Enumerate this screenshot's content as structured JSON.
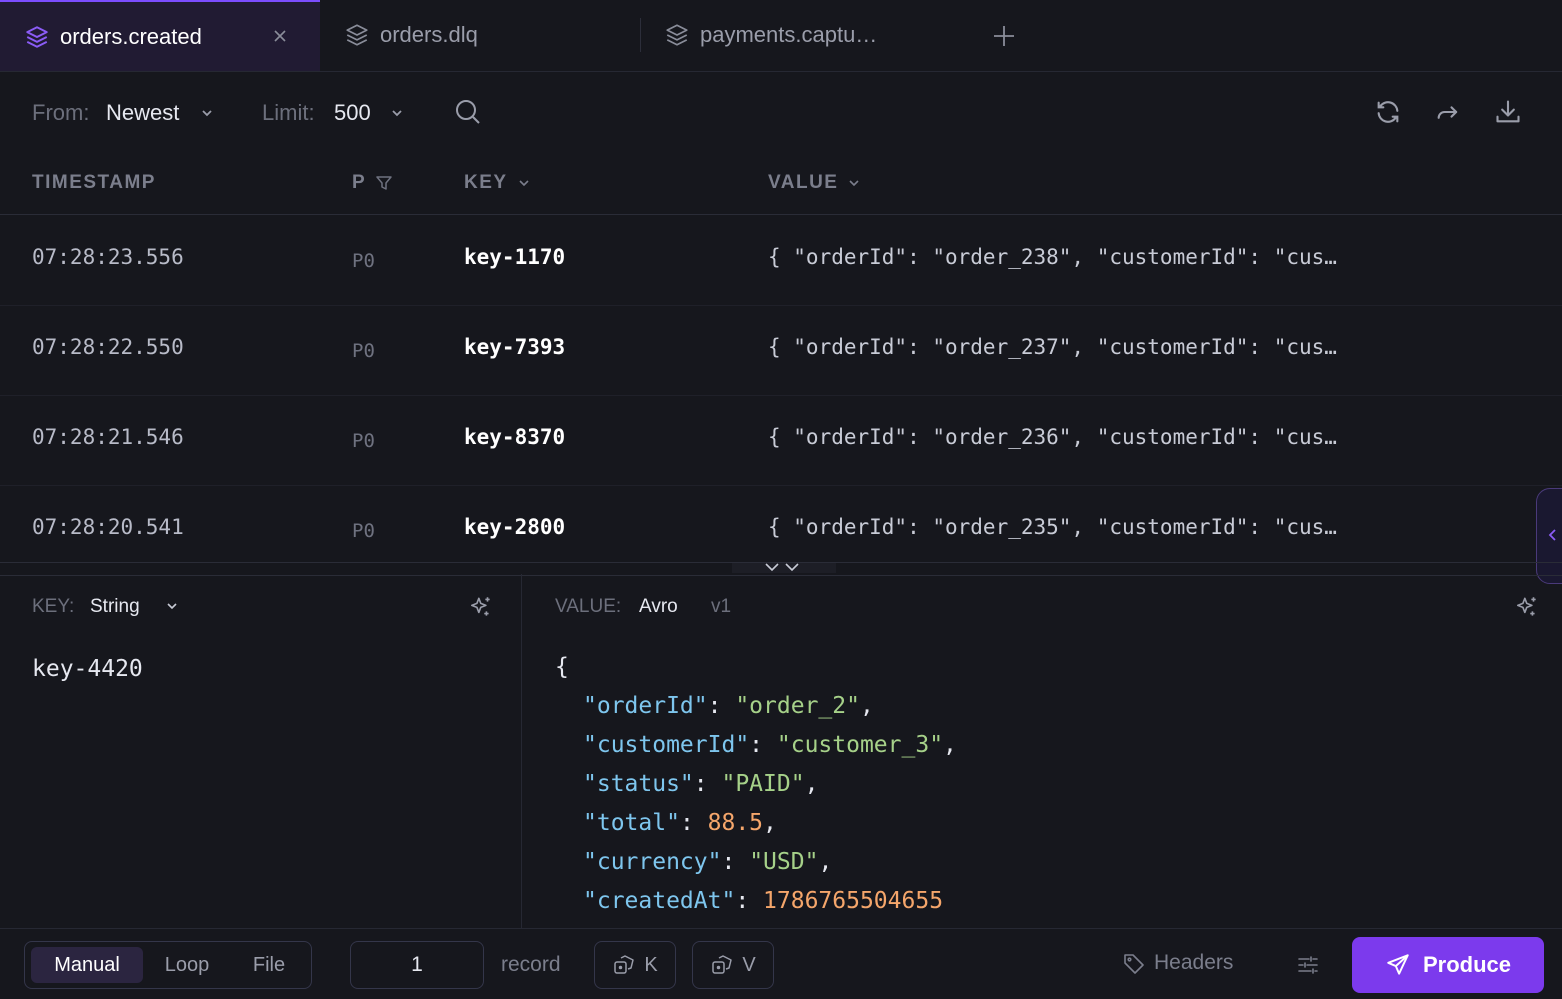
{
  "tabs": [
    {
      "label": "orders.created",
      "icon": "layers-icon",
      "active": true
    },
    {
      "label": "orders.dlq",
      "icon": "layers-icon",
      "active": false
    },
    {
      "label": "payments.captu…",
      "icon": "layers-icon",
      "active": false
    }
  ],
  "toolbar": {
    "from_label": "From:",
    "from_value": "Newest",
    "limit_label": "Limit:",
    "limit_value": "500",
    "icons": [
      "search-icon",
      "refresh-icon",
      "forward-icon",
      "download-icon"
    ]
  },
  "table": {
    "headers": {
      "timestamp": "TIMESTAMP",
      "partition": "P",
      "key": "KEY",
      "value": "VALUE"
    },
    "rows": [
      {
        "timestamp": "07:28:23.556",
        "partition": "P0",
        "key": "key-1170",
        "value": "{ \"orderId\": \"order_238\", \"customerId\": \"cus…"
      },
      {
        "timestamp": "07:28:22.550",
        "partition": "P0",
        "key": "key-7393",
        "value": "{ \"orderId\": \"order_237\", \"customerId\": \"cus…"
      },
      {
        "timestamp": "07:28:21.546",
        "partition": "P0",
        "key": "key-8370",
        "value": "{ \"orderId\": \"order_236\", \"customerId\": \"cus…"
      },
      {
        "timestamp": "07:28:20.541",
        "partition": "P0",
        "key": "key-2800",
        "value": "{ \"orderId\": \"order_235\", \"customerId\": \"cus…"
      }
    ]
  },
  "key_editor": {
    "label": "KEY:",
    "format": "String",
    "content": "key-4420"
  },
  "value_editor": {
    "label": "VALUE:",
    "format": "Avro",
    "version": "v1",
    "open_brace": "{",
    "fields": [
      {
        "key": "\"orderId\"",
        "value": "\"order_2\"",
        "type": "string",
        "comma": ","
      },
      {
        "key": "\"customerId\"",
        "value": "\"customer_3\"",
        "type": "string",
        "comma": ","
      },
      {
        "key": "\"status\"",
        "value": "\"PAID\"",
        "type": "string",
        "comma": ","
      },
      {
        "key": "\"total\"",
        "value": "88.5",
        "type": "number",
        "comma": ","
      },
      {
        "key": "\"currency\"",
        "value": "\"USD\"",
        "type": "string",
        "comma": ","
      },
      {
        "key": "\"createdAt\"",
        "value": "1786765504655",
        "type": "number",
        "comma": ""
      }
    ]
  },
  "bottom": {
    "modes": [
      "Manual",
      "Loop",
      "File"
    ],
    "active_mode": "Manual",
    "count": "1",
    "count_unit": "record",
    "key_button": "K",
    "value_button": "V",
    "headers_label": "Headers",
    "produce_label": "Produce"
  },
  "colors": {
    "accent": "#7c3aed",
    "background": "#16171d",
    "json_key": "#7ec6ee",
    "json_string": "#a6d189",
    "json_number": "#f5a66b"
  }
}
